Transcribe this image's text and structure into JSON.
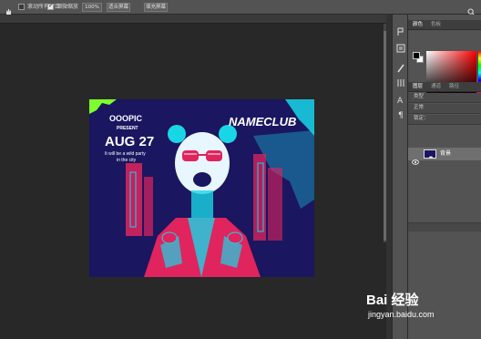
{
  "options_bar": {
    "scroll_all_label": "滚动所有窗口",
    "scrubby_zoom_label": "细微缩放",
    "zoom_value": "100%",
    "fit_screen_label": "适合屏幕",
    "fill_screen_label": "填充屏幕"
  },
  "canvas_art": {
    "brand": "OOOPIC",
    "present": "PRESENT",
    "date": "AUG 27",
    "tagline_1": "It will be a wild party",
    "tagline_2": "in the city",
    "club": "NAMECLUB"
  },
  "panels": {
    "color_tab": "颜色",
    "swatches_tab": "色板",
    "layers_tab": "图层",
    "channels_tab": "通道",
    "paths_tab": "路径",
    "kind_label": "类型",
    "normal_label": "正常",
    "lock_label": "锁定：",
    "layer_name": "背景"
  },
  "watermark": {
    "logo_text": "Bai 经验",
    "url": "jingyan.baidu.com"
  },
  "colors": {
    "canvas_bg": "#1a1660",
    "accent_cyan": "#19d6e6",
    "accent_magenta": "#e0245e",
    "accent_lime": "#7dff2b"
  }
}
